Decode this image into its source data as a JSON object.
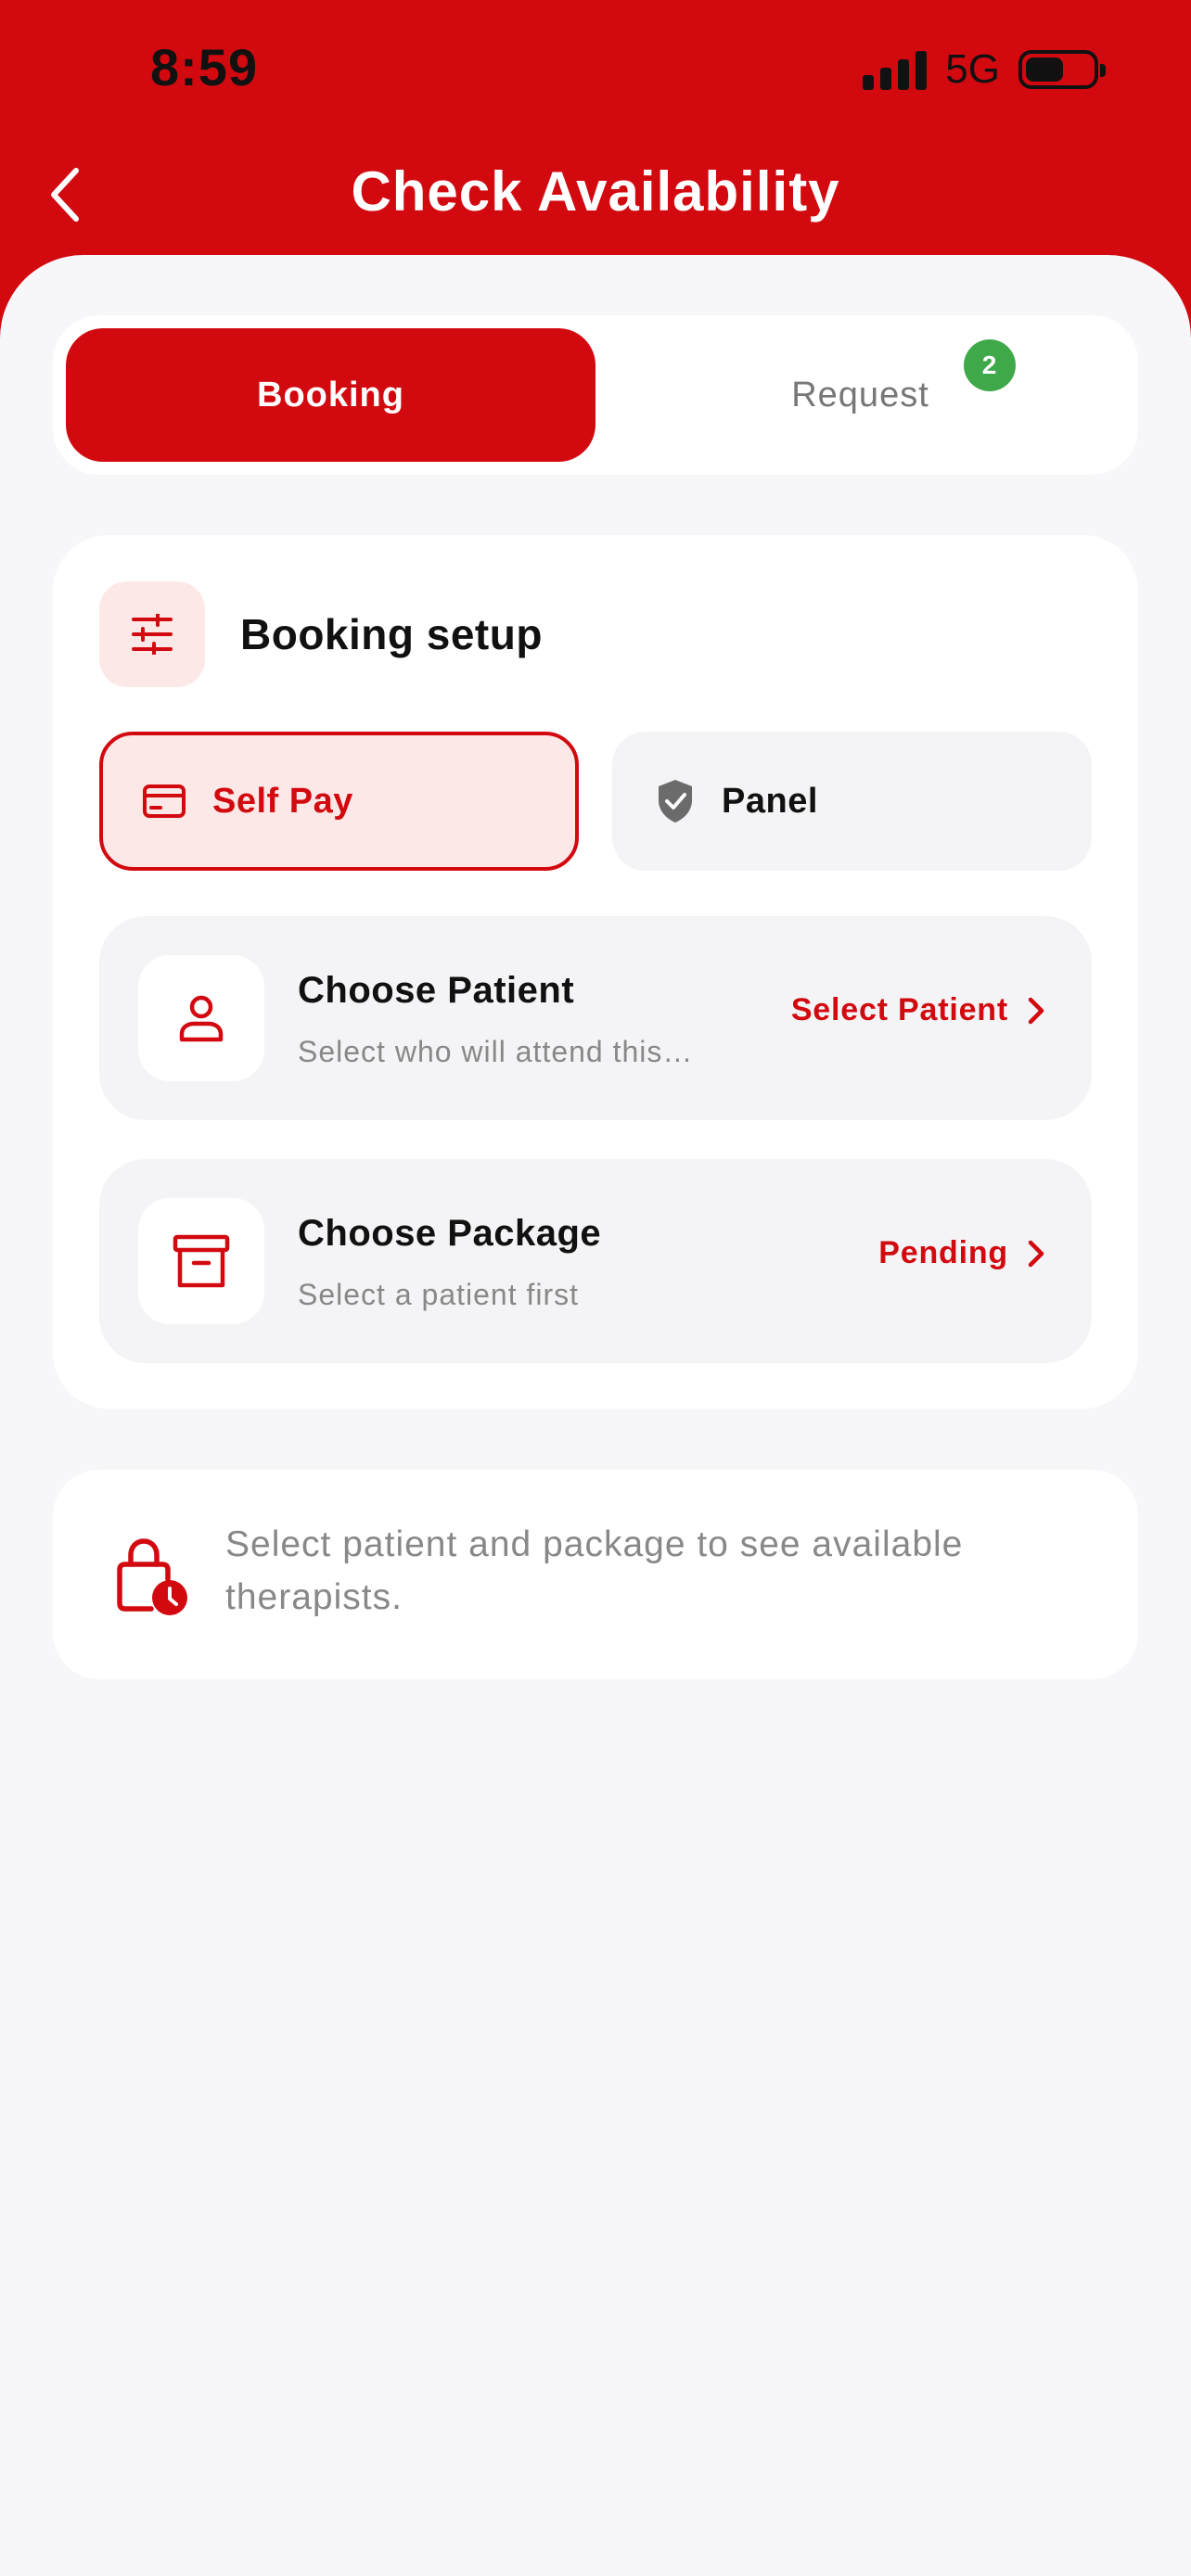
{
  "status_bar": {
    "time": "8:59",
    "network": "5G"
  },
  "header": {
    "title": "Check Availability"
  },
  "tabs": [
    {
      "label": "Booking",
      "active": true
    },
    {
      "label": "Request",
      "active": false,
      "badge": "2"
    }
  ],
  "setup": {
    "title": "Booking setup",
    "payment_options": [
      {
        "label": "Self Pay",
        "icon": "credit-card-icon",
        "selected": true
      },
      {
        "label": "Panel",
        "icon": "shield-check-icon",
        "selected": false
      }
    ],
    "patient": {
      "title": "Choose Patient",
      "subtitle": "Select who will attend this…",
      "action": "Select Patient",
      "icon": "user-icon"
    },
    "package": {
      "title": "Choose Package",
      "subtitle": "Select a patient first",
      "action": "Pending",
      "icon": "archive-box-icon"
    }
  },
  "info": {
    "text": "Select patient and package to see available therapists.",
    "icon": "lock-clock-icon"
  },
  "colors": {
    "primary": "#d20a10",
    "primary_tint": "#fde8e8",
    "badge": "#3fa94a",
    "background": "#f7f7f9",
    "muted_text": "#888888"
  }
}
